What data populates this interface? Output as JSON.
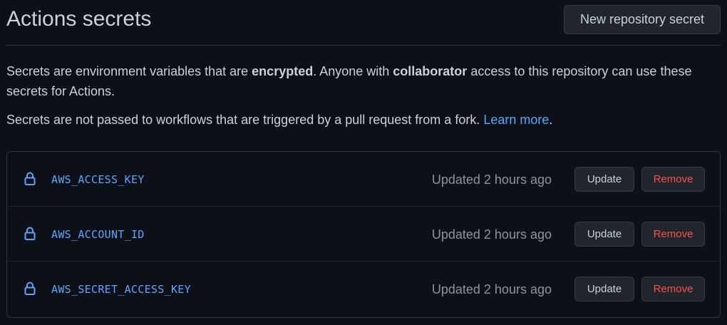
{
  "header": {
    "title": "Actions secrets",
    "new_secret_label": "New repository secret"
  },
  "description": {
    "line1_part1": "Secrets are environment variables that are ",
    "line1_bold1": "encrypted",
    "line1_part2": ". Anyone with ",
    "line1_bold2": "collaborator",
    "line1_part3": " access to this repository can use these secrets for Actions.",
    "line2_text": "Secrets are not passed to workflows that are triggered by a pull request from a fork. ",
    "learn_more": "Learn more",
    "line2_end": "."
  },
  "secrets": [
    {
      "name": "AWS_ACCESS_KEY",
      "updated": "Updated 2 hours ago",
      "update_label": "Update",
      "remove_label": "Remove",
      "icon": "lock-icon"
    },
    {
      "name": "AWS_ACCOUNT_ID",
      "updated": "Updated 2 hours ago",
      "update_label": "Update",
      "remove_label": "Remove",
      "icon": "lock-icon"
    },
    {
      "name": "AWS_SECRET_ACCESS_KEY",
      "updated": "Updated 2 hours ago",
      "update_label": "Update",
      "remove_label": "Remove",
      "icon": "lock-icon"
    }
  ],
  "colors": {
    "background": "#0d1117",
    "text": "#c9d1d9",
    "muted": "#8b949e",
    "link": "#58a6ff",
    "danger": "#f85149",
    "border": "#30363d",
    "button_bg": "#21262d"
  }
}
